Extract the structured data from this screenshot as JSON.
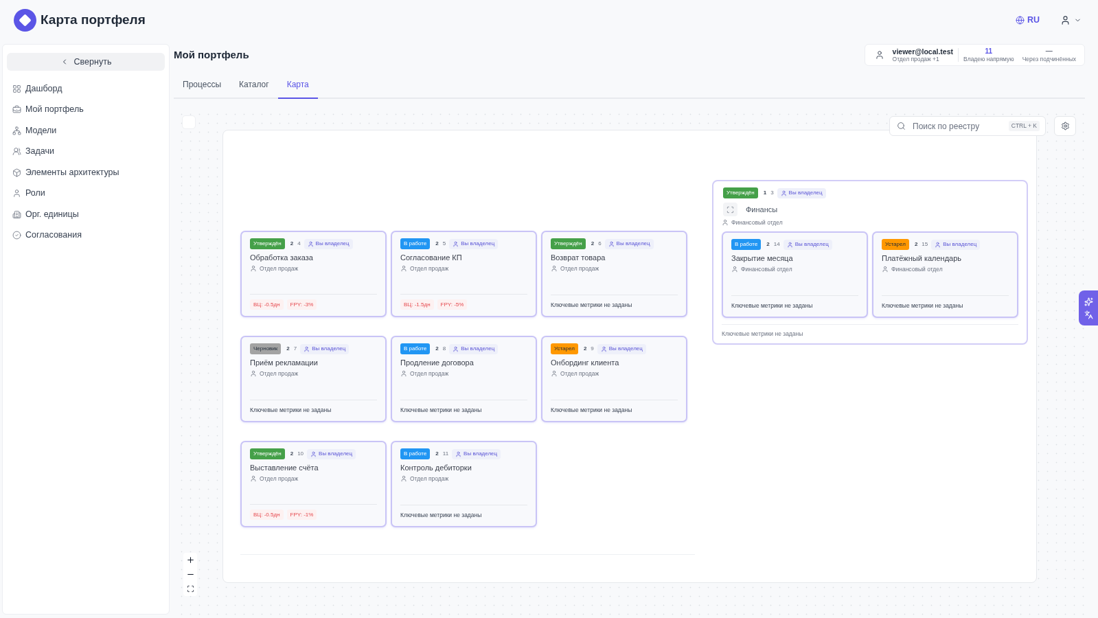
{
  "app_header": {
    "title": "Карта портфеля",
    "language": "RU"
  },
  "sidebar": {
    "collapse_label": "Свернуть",
    "items": [
      {
        "label": "Дашборд",
        "selected": false
      },
      {
        "label": "Мой портфель",
        "selected": false
      },
      {
        "label": "Модели",
        "selected": false
      },
      {
        "label": "Задачи",
        "selected": false
      },
      {
        "label": "Элементы архитектуры",
        "selected": false
      },
      {
        "label": "Роли",
        "selected": false
      },
      {
        "label": "Орг. единицы",
        "selected": false
      },
      {
        "label": "Согласования",
        "selected": false
      }
    ]
  },
  "page": {
    "title": "Мой портфель"
  },
  "user_summary": {
    "email": "viewer@local.test",
    "unit": "Отдел продаж +1",
    "stats": [
      {
        "value": "11",
        "label": "Владею напрямую",
        "kind": "count"
      },
      {
        "value": "—",
        "label": "Через подчинённых",
        "kind": "empty"
      }
    ]
  },
  "tabs": [
    {
      "label": "Процессы",
      "selected": false
    },
    {
      "label": "Каталог",
      "selected": false
    },
    {
      "label": "Карта",
      "selected": true
    }
  ],
  "map": {
    "search": {
      "placeholder": "Поиск по реестру",
      "shortcut": "CTRL + K"
    },
    "cards": [
      {
        "status": {
          "label": "Утверждён",
          "color": "#45a049"
        },
        "numbers": [
          "2",
          "4"
        ],
        "owner": "Вы владелец",
        "title": "Обработка заказа",
        "department": "Отдел продаж",
        "metrics": [
          "ВЦ: -0.5дн",
          "FPY: -3%"
        ]
      },
      {
        "status": {
          "label": "В работе",
          "color": "#2196f3"
        },
        "numbers": [
          "2",
          "5"
        ],
        "owner": "Вы владелец",
        "title": "Согласование КП",
        "department": "Отдел продаж",
        "metrics": [
          "ВЦ: -1.5дн",
          "FPY: -5%"
        ]
      },
      {
        "status": {
          "label": "Утверждён",
          "color": "#45a049"
        },
        "numbers": [
          "2",
          "6"
        ],
        "owner": "Вы владелец",
        "title": "Возврат товара",
        "department": "Отдел продаж",
        "metrics_note": "Ключевые метрики не заданы"
      },
      {
        "status": {
          "label": "Черновик",
          "color": "#a3a3a3"
        },
        "numbers": [
          "2",
          "7"
        ],
        "owner": "Вы владелец",
        "title": "Приём рекламации",
        "department": "Отдел продаж",
        "metrics_note": "Ключевые метрики не заданы"
      },
      {
        "status": {
          "label": "В работе",
          "color": "#2196f3"
        },
        "numbers": [
          "2",
          "8"
        ],
        "owner": "Вы владелец",
        "title": "Продление договора",
        "department": "Отдел продаж",
        "metrics_note": "Ключевые метрики не заданы"
      },
      {
        "status": {
          "label": "Устарел",
          "color": "#ff9800"
        },
        "numbers": [
          "2",
          "9"
        ],
        "owner": "Вы владелец",
        "title": "Онбординг клиента",
        "department": "Отдел продаж",
        "metrics_note": "Ключевые метрики не заданы"
      },
      {
        "status": {
          "label": "Утверждён",
          "color": "#45a049"
        },
        "numbers": [
          "2",
          "10"
        ],
        "owner": "Вы владелец",
        "title": "Выставление счёта",
        "department": "Отдел продаж",
        "metrics": [
          "ВЦ: -0.5дн",
          "FPY: -1%"
        ]
      },
      {
        "status": {
          "label": "В работе",
          "color": "#2196f3"
        },
        "numbers": [
          "2",
          "11"
        ],
        "owner": "Вы владелец",
        "title": "Контроль дебиторки",
        "department": "Отдел продаж",
        "metrics_note": "Ключевые метрики не заданы"
      }
    ],
    "groups": [
      {
        "status": {
          "label": "Утверждён",
          "color": "#45a049"
        },
        "numbers": [
          "1",
          "3"
        ],
        "owner": "Вы владелец",
        "title": "Финансы",
        "department": "Финансовый отдел",
        "children": [
          {
            "status": {
              "label": "В работе",
              "color": "#2196f3"
            },
            "numbers": [
              "2",
              "14"
            ],
            "owner": "Вы владелец",
            "title": "Закрытие месяца",
            "department": "Финансовый отдел",
            "metrics_note": "Ключевые метрики не заданы"
          },
          {
            "status": {
              "label": "Устарел",
              "color": "#ff9800"
            },
            "numbers": [
              "2",
              "15"
            ],
            "owner": "Вы владелец",
            "title": "Платёжный календарь",
            "department": "Финансовый отдел",
            "metrics_note": "Ключевые метрики не заданы"
          }
        ],
        "metrics_note": "Ключевые метрики не заданы"
      }
    ]
  }
}
